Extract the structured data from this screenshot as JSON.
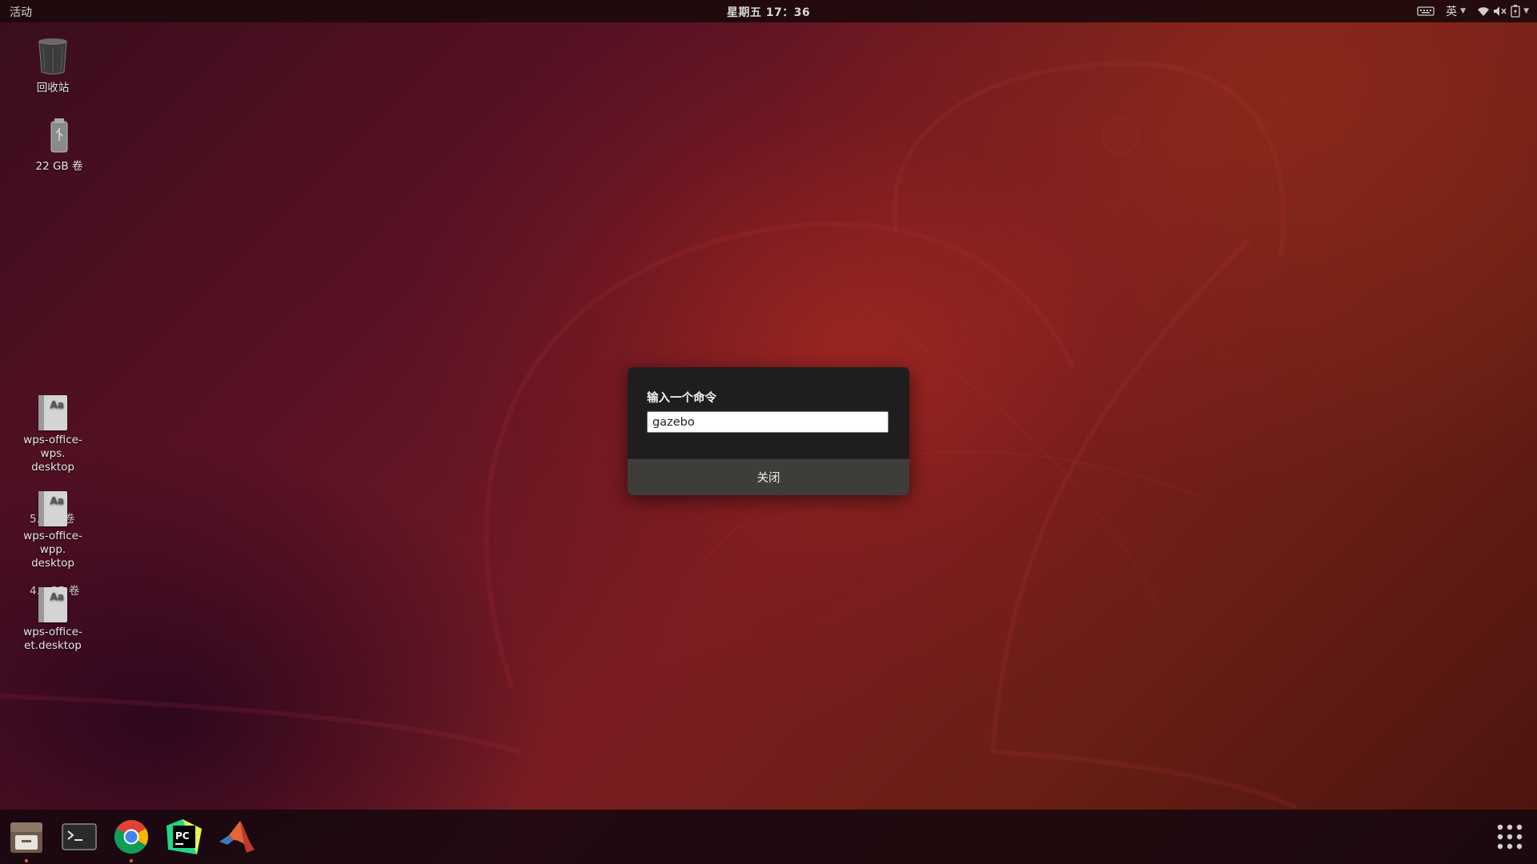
{
  "topbar": {
    "activities": "活动",
    "clock": "星期五 17：36",
    "input_method": "英"
  },
  "desktop_icons": {
    "trash": {
      "label": "回收站"
    },
    "volume_22": {
      "label": "22 GB 卷"
    },
    "wps_writer": {
      "label_line1": "wps-office-",
      "label_line2": "wps.",
      "label_line3": "desktop"
    },
    "wps_presentation": {
      "label_line1": "wps-office-",
      "label_line2": "wpp.",
      "label_line3": "desktop"
    },
    "wps_spreadsheet": {
      "label_line1": "wps-office-",
      "label_line2": "et.desktop"
    },
    "overlapped_volume_a": "5.",
    "overlapped_volume_a_suffix": "卷",
    "overlapped_volume_b": "4.",
    "overlapped_volume_b_suffix": "GB 卷",
    "doc_glyph": "Aa"
  },
  "run_dialog": {
    "title": "输入一个命令",
    "input_value": "gazebo",
    "close_label": "关闭"
  },
  "dock": {
    "apps": [
      {
        "name": "files",
        "running": true
      },
      {
        "name": "terminal",
        "running": false
      },
      {
        "name": "chrome",
        "running": true
      },
      {
        "name": "pycharm",
        "running": false
      },
      {
        "name": "matlab",
        "running": false
      }
    ],
    "show_apps": "apps-grid-icon"
  },
  "colors": {
    "accent": "#e8632a",
    "dialog_bg": "#1f1d1d",
    "dialog_button": "#3f3d3a"
  }
}
